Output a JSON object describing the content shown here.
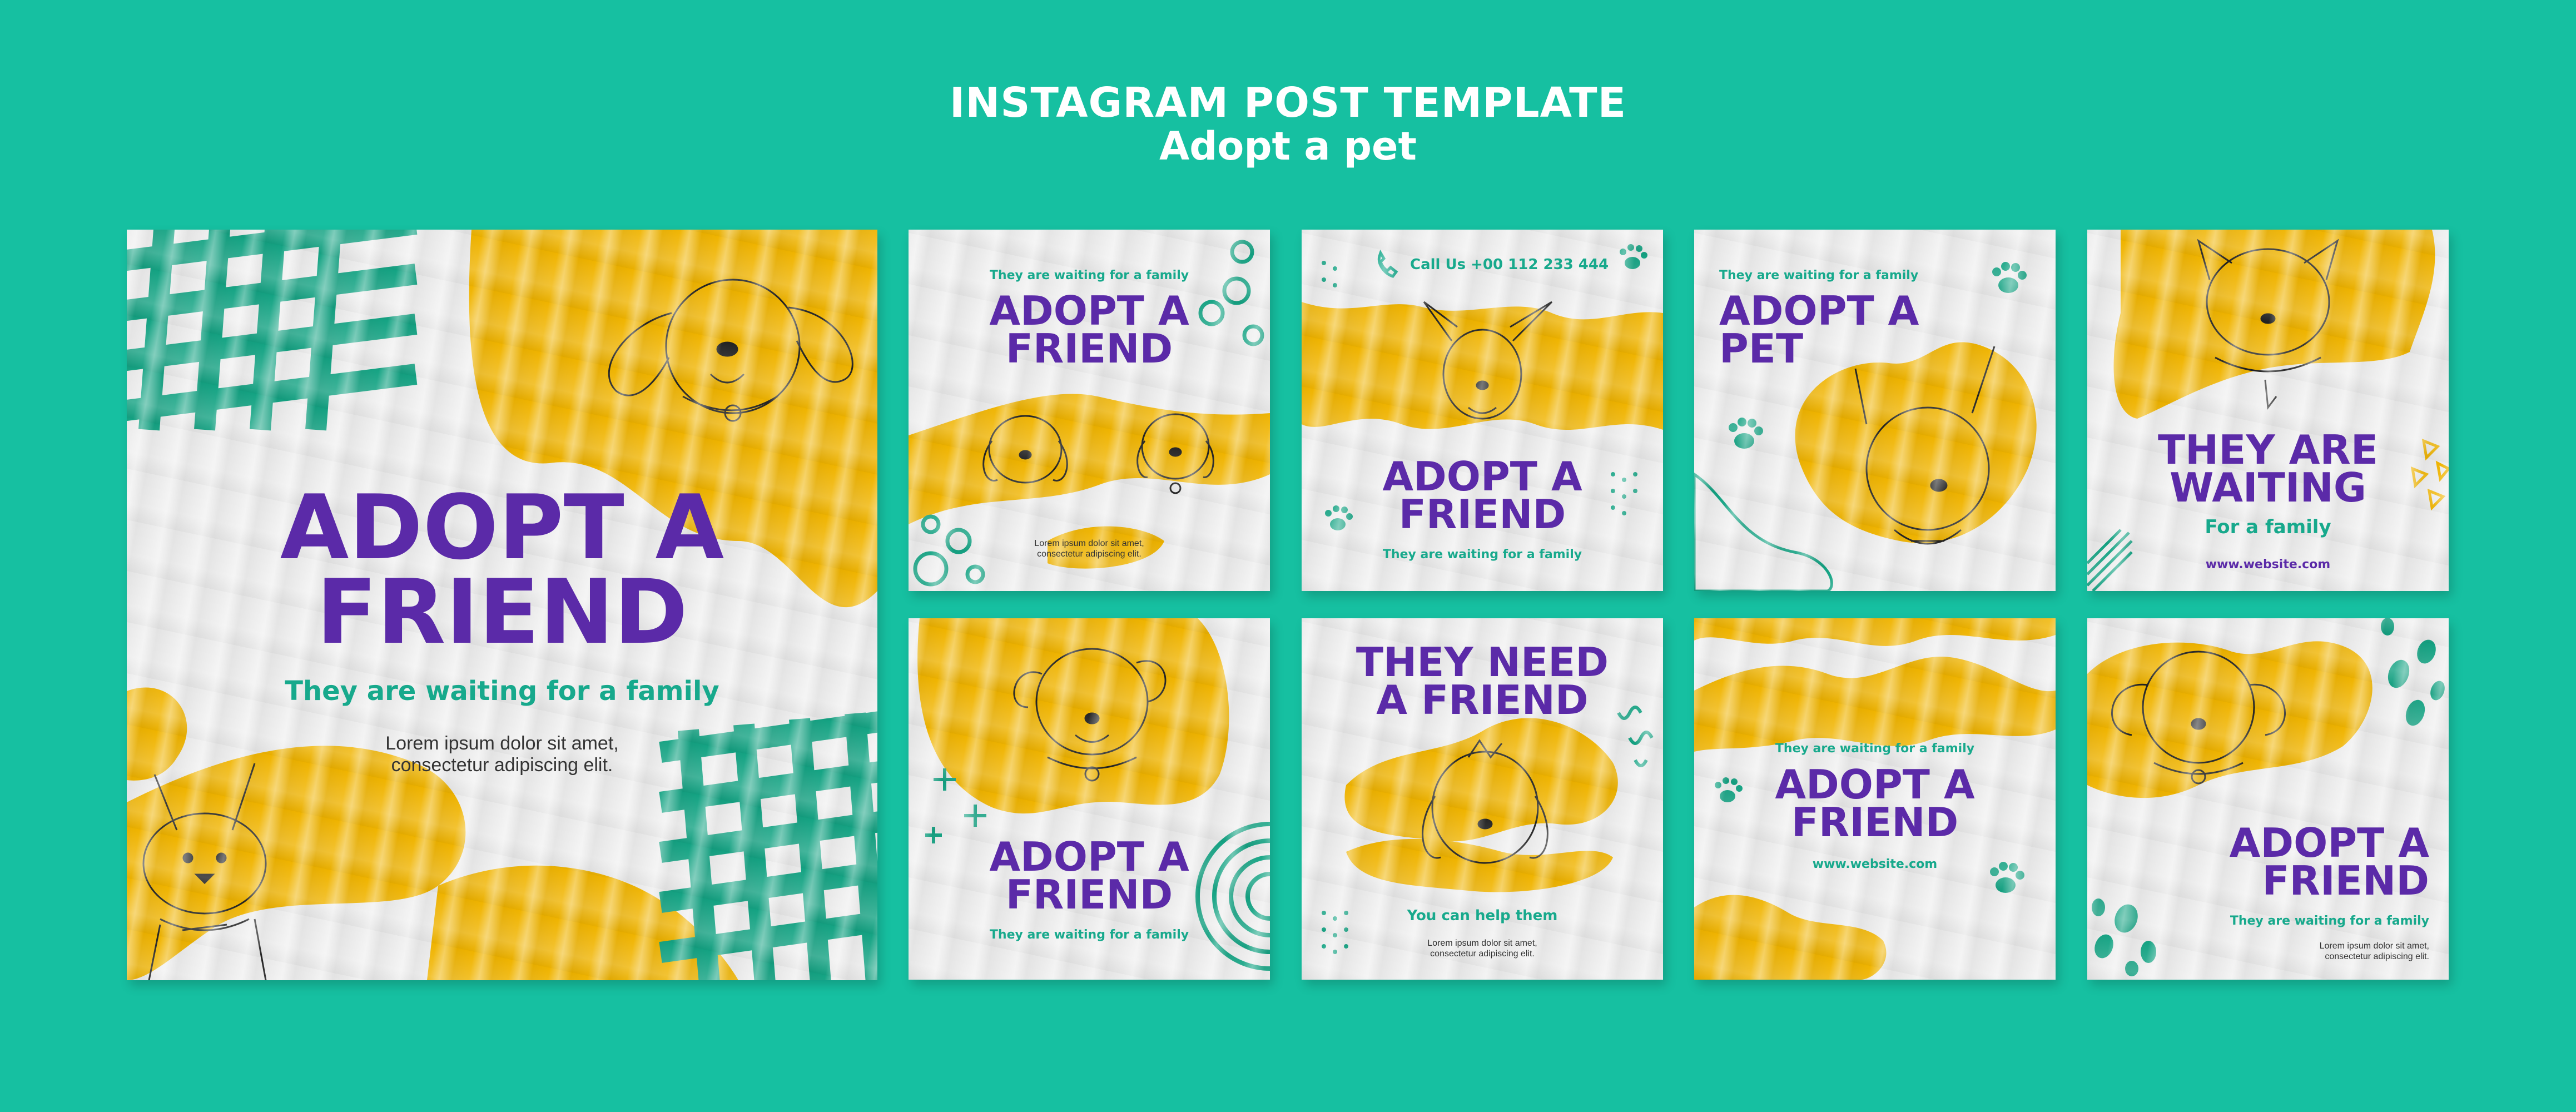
{
  "header": {
    "title": "INSTAGRAM POST TEMPLATE",
    "subtitle": "Adopt a pet"
  },
  "colors": {
    "background": "#16c0a1",
    "purple": "#5b2aa8",
    "teal": "#17a98c",
    "mustard": "#f0b400",
    "paper": "#ececec"
  },
  "large": {
    "headline_1": "ADOPT A",
    "headline_2": "FRIEND",
    "tagline": "They are waiting for a family",
    "body_1": "Lorem ipsum dolor sit amet,",
    "body_2": "consectetur adipiscing elit."
  },
  "post1": {
    "tagline": "They are waiting for a family",
    "headline_1": "ADOPT A",
    "headline_2": "FRIEND",
    "body_1": "Lorem ipsum dolor sit amet,",
    "body_2": "consectetur adipiscing elit."
  },
  "post2": {
    "phone": "Call Us +00 112 233 444",
    "headline_1": "ADOPT A",
    "headline_2": "FRIEND",
    "tagline": "They are waiting for a family"
  },
  "post3": {
    "tagline": "They are waiting for a family",
    "headline_1": "ADOPT A",
    "headline_2": "PET"
  },
  "post4": {
    "headline_1": "THEY ARE",
    "headline_2": "WAITING",
    "tagline": "For a family",
    "website": "www.website.com"
  },
  "post5": {
    "headline_1": "ADOPT A",
    "headline_2": "FRIEND",
    "tagline": "They are waiting for a family"
  },
  "post6": {
    "headline_1": "THEY NEED",
    "headline_2": "A FRIEND",
    "tagline": "You can help them",
    "body_1": "Lorem ipsum dolor sit amet,",
    "body_2": "consectetur adipiscing elit."
  },
  "post7": {
    "tagline": "They are waiting for a family",
    "headline_1": "ADOPT A",
    "headline_2": "FRIEND",
    "website": "www.website.com"
  },
  "post8": {
    "headline_1": "ADOPT A",
    "headline_2": "FRIEND",
    "tagline": "They are waiting for a family",
    "body_1": "Lorem ipsum dolor sit amet,",
    "body_2": "consectetur adipiscing elit."
  }
}
